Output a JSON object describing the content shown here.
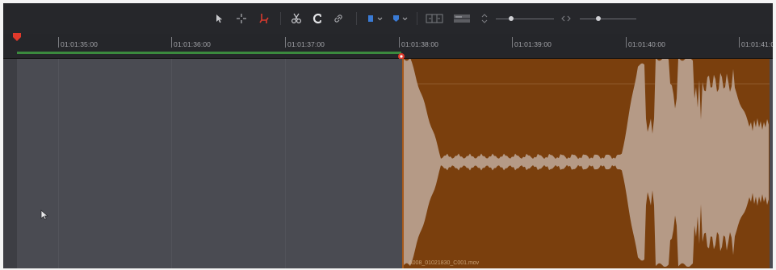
{
  "toolbar": {
    "icons": [
      {
        "name": "selection-tool-icon",
        "active": true
      },
      {
        "name": "trim-tool-icon"
      },
      {
        "name": "dynamic-trim-icon",
        "active_color": "#d83a2e"
      },
      {
        "name": "blade-tool-icon"
      },
      {
        "name": "snapping-icon"
      },
      {
        "name": "linked-selection-icon"
      },
      {
        "name": "flag-icon",
        "color": "#3a7bd5"
      },
      {
        "name": "marker-icon",
        "color": "#3a7bd5"
      },
      {
        "name": "full-extent-zoom-icon"
      },
      {
        "name": "detail-zoom-icon"
      },
      {
        "name": "zoom-level-icon"
      },
      {
        "name": "zoom-slider-icon"
      },
      {
        "name": "track-height-icon"
      }
    ]
  },
  "ruler": {
    "timecodes": [
      "01:01:35:00",
      "01:01:36:00",
      "01:01:37:00",
      "01:01:38:00",
      "01:01:39:00",
      "01:01:40:00",
      "01:01:41:0"
    ]
  },
  "clip": {
    "name": "A008_01021830_C001.mov",
    "color": "#7a3f0d"
  },
  "colors": {
    "playhead": "#e0392b",
    "range_bar": "#3b8a3e",
    "track_background": "#4a4b52",
    "waveform": "#b59a86"
  }
}
